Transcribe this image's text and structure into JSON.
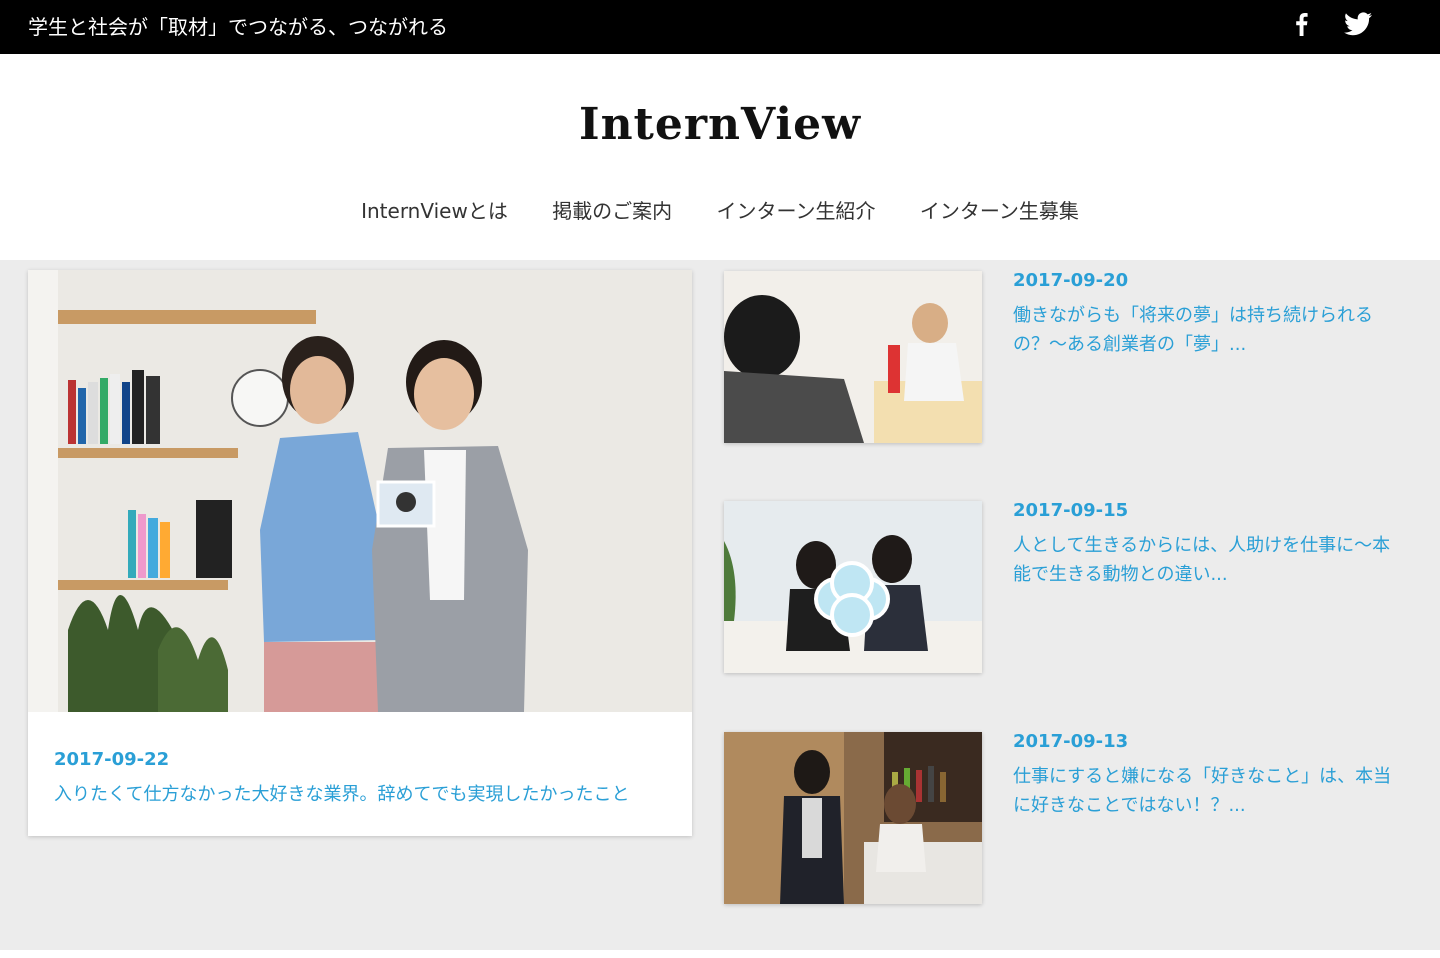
{
  "topbar": {
    "tagline": "学生と社会が「取材」でつながる、つながれる",
    "social": [
      {
        "icon": "facebook-icon"
      },
      {
        "icon": "twitter-icon"
      }
    ]
  },
  "header": {
    "logo": "InternView"
  },
  "nav": {
    "items": [
      {
        "label": "InternViewとは"
      },
      {
        "label": "掲載のご案内"
      },
      {
        "label": "インターン生紹介"
      },
      {
        "label": "インターン生募集"
      }
    ]
  },
  "featured": {
    "date": "2017-09-22",
    "title": "入りたくて仕方なかった大好きな業界。辞めてでも実現したかったこと"
  },
  "articles": [
    {
      "date": "2017-09-20",
      "title": "働きながらも「将来の夢」は持ち続けられるの？～ある創業者の「夢」..."
    },
    {
      "date": "2017-09-15",
      "title": "人として生きるからには、人助けを仕事に～本能で生きる動物との違い..."
    },
    {
      "date": "2017-09-13",
      "title": "仕事にすると嫌になる「好きなこと」は、本当に好きなことではない！？..."
    }
  ],
  "colors": {
    "accent": "#2a9fd6",
    "topbar_bg": "#000000",
    "page_bg": "#ececec"
  }
}
